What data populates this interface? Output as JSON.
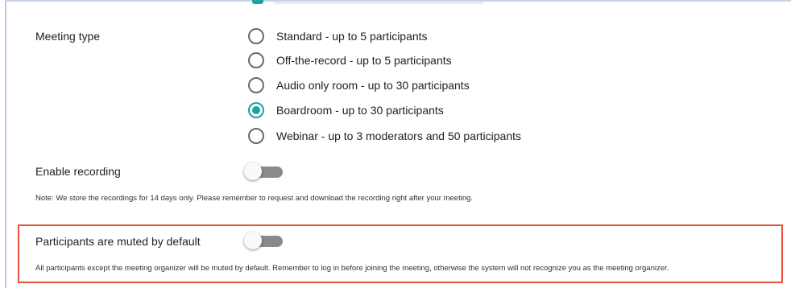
{
  "meeting_type": {
    "label": "Meeting type",
    "options": [
      {
        "label": "Standard - up to 5 participants",
        "selected": false
      },
      {
        "label": "Off-the-record - up to 5 participants",
        "selected": false
      },
      {
        "label": "Audio only room - up to 30 participants",
        "selected": false
      },
      {
        "label": "Boardroom - up to 30 participants",
        "selected": true
      },
      {
        "label": "Webinar - up to 3 moderators and 50 participants",
        "selected": false
      }
    ]
  },
  "recording": {
    "label": "Enable recording",
    "enabled": false,
    "note": "Note: We store the recordings for 14 days only. Please remember to request and download the recording right after your meeting."
  },
  "mute_default": {
    "label": "Participants are muted by default",
    "enabled": false,
    "note": "All participants except the meeting organizer will be muted by default. Remember to log in before joining the meeting, otherwise the system will not recognize you as the meeting organizer."
  },
  "colors": {
    "accent": "#1aa3a3",
    "highlight": "#e8533a",
    "toggle_track": "#8a8a8a"
  }
}
